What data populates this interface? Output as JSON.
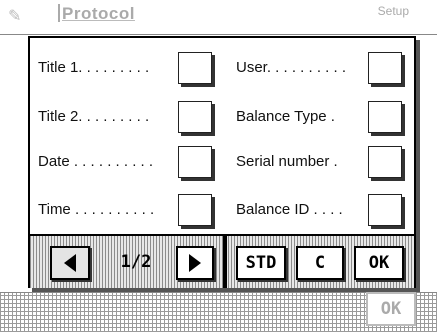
{
  "background": {
    "title": "Protocol",
    "setup_label": "Setup",
    "ok_label": "OK"
  },
  "dialog": {
    "left_items": [
      {
        "label": "Title 1. . . . . . . . ."
      },
      {
        "label": "Title 2. . . . . . . . ."
      },
      {
        "label": "Date . . . . . . . . . ."
      },
      {
        "label": "Time . . . . . . . . . ."
      }
    ],
    "right_items": [
      {
        "label": "User. . . . . . . . . ."
      },
      {
        "label": "Balance Type ."
      },
      {
        "label": "Serial number ."
      },
      {
        "label": "Balance ID . . . ."
      }
    ],
    "toolbar": {
      "page": "1/2",
      "std_label": "STD",
      "c_label": "C",
      "ok_label": "OK"
    }
  }
}
